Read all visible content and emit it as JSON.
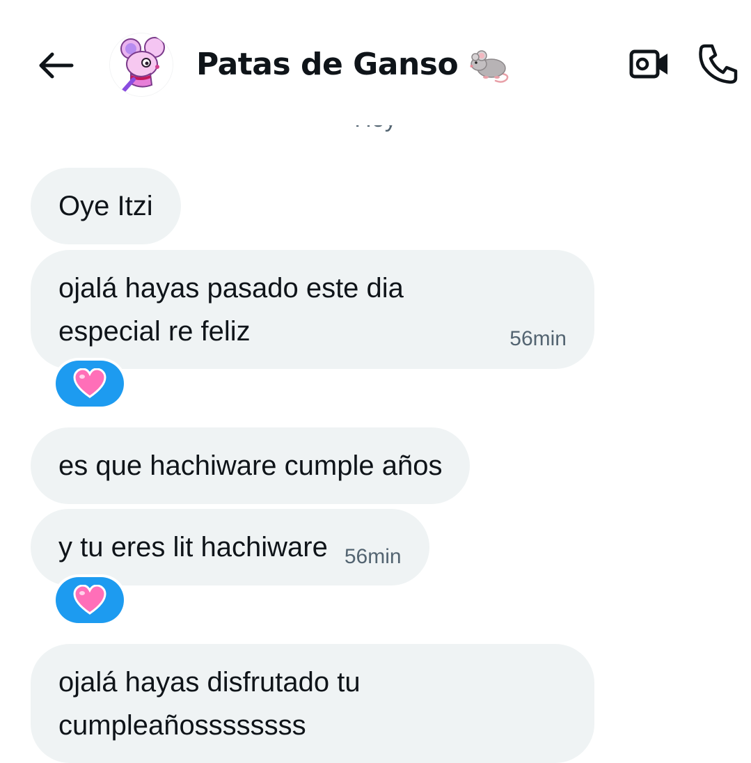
{
  "header": {
    "back_icon": "arrow-left-icon",
    "avatar_icon": "pink-mouse-avatar",
    "contact_name": "Patas de Ganso",
    "name_emoji": "mouse-emoji",
    "video_icon": "video-camera-icon",
    "phone_icon": "phone-icon"
  },
  "day_divider": "Hoy",
  "messages": [
    {
      "lines": [
        "Oye Itzi"
      ],
      "timestamp": ""
    },
    {
      "lines": [
        "ojalá hayas pasado este dia",
        "especial re feliz"
      ],
      "timestamp": "56min",
      "reaction": "pink-heart-emoji"
    },
    {
      "lines": [
        "es que hachiware cumple años"
      ],
      "timestamp": ""
    },
    {
      "lines": [
        "y tu eres lit hachiware"
      ],
      "timestamp": "56min",
      "reaction": "pink-heart-emoji"
    },
    {
      "lines": [
        "ojalá hayas disfrutado tu",
        "cumpleañossssssss"
      ],
      "timestamp": ""
    }
  ],
  "colors": {
    "bubble_bg": "#eff3f4",
    "text": "#0f1419",
    "secondary_text": "#536471",
    "reaction_bg": "#1d9bf0",
    "heart": "#ff6fb8"
  }
}
